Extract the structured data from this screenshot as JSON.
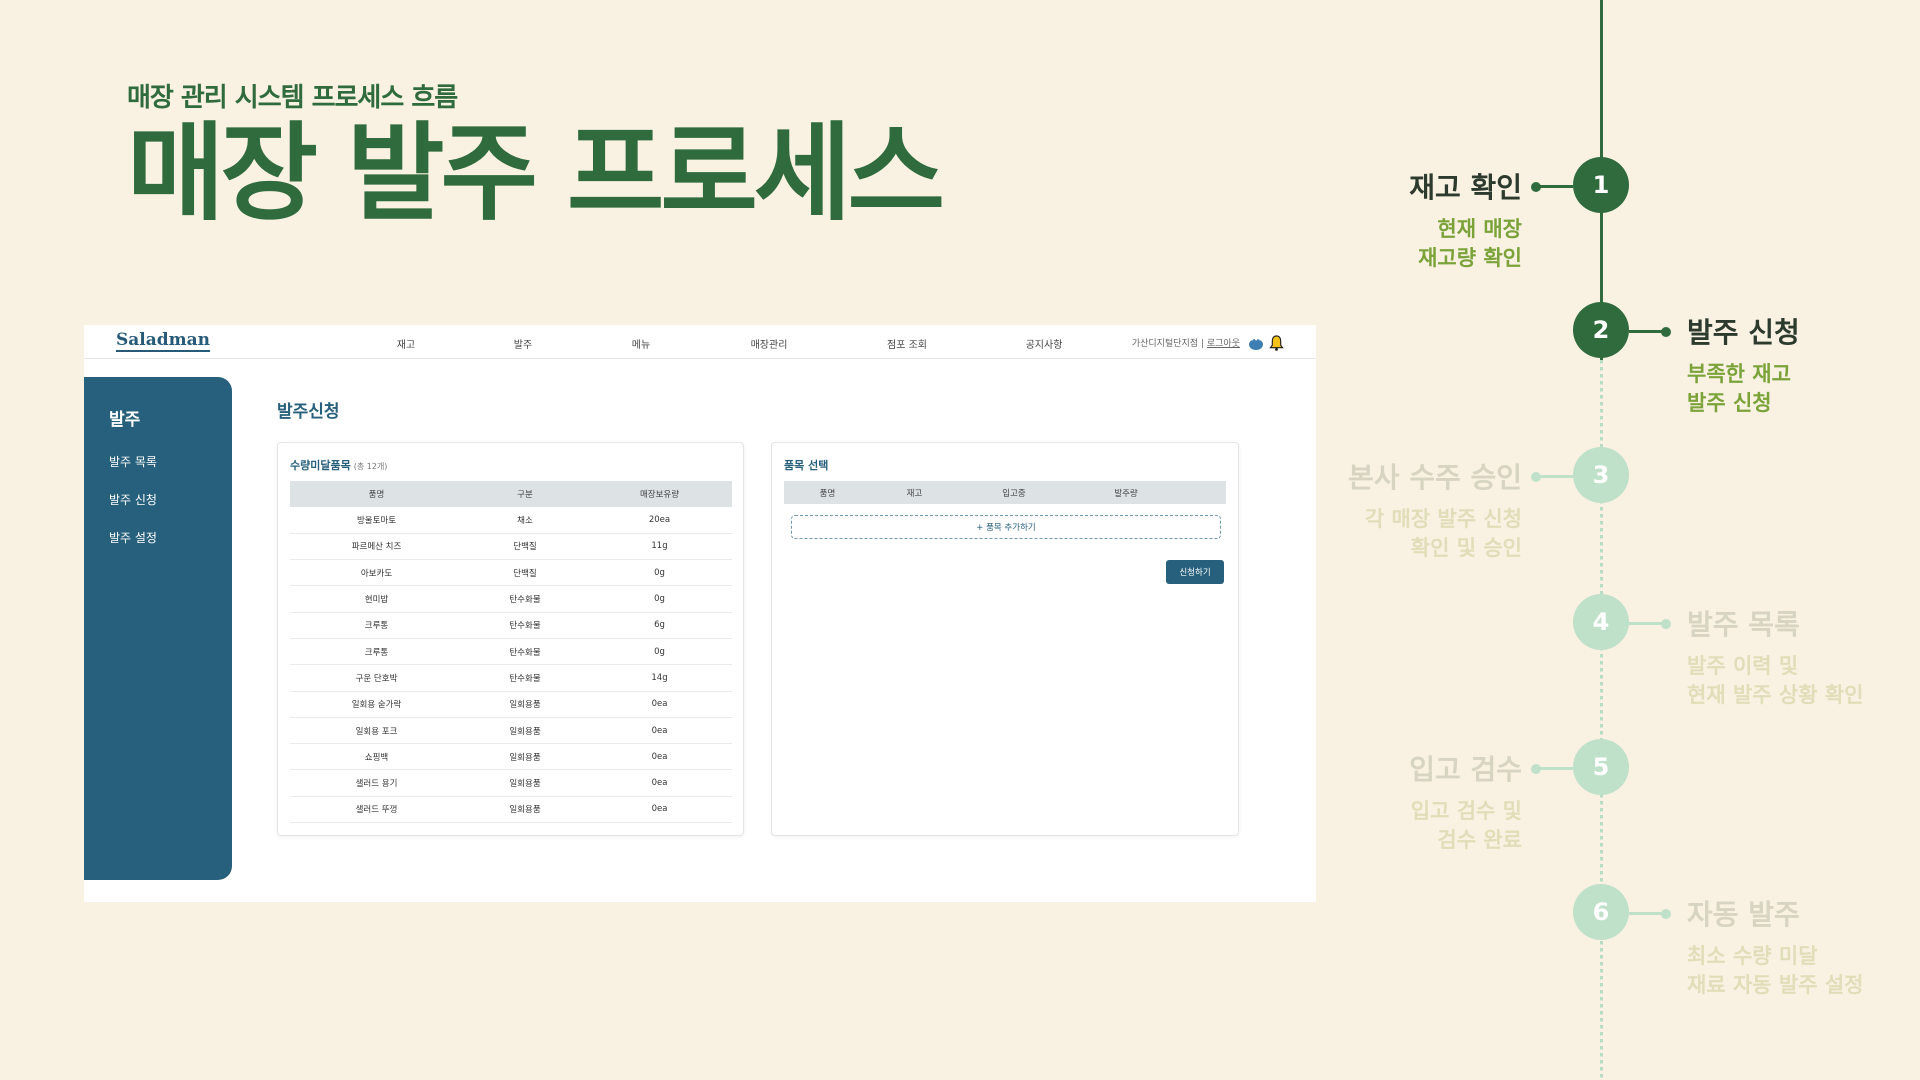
{
  "subtitle": "매장 관리 시스템 프로세스 흐름",
  "title": "매장 발주 프로세스",
  "app": {
    "logo": "Saladman",
    "nav": [
      "재고",
      "발주",
      "메뉴",
      "매장관리",
      "점포 조회",
      "공지사항"
    ],
    "store_name": "가산디지털단지점",
    "separator": "|",
    "logout": "로그아웃",
    "sidebar": {
      "title": "발주",
      "items": [
        "발주 목록",
        "발주 신청",
        "발주 설정"
      ]
    },
    "page_title": "발주신청",
    "shortage_panel": {
      "title": "수량미달품목",
      "count": "(총 12개)",
      "headers": [
        "품명",
        "구분",
        "매장보유량"
      ],
      "rows": [
        [
          "방울토마토",
          "채소",
          "20ea"
        ],
        [
          "파르메산 치즈",
          "단백질",
          "11g"
        ],
        [
          "아보카도",
          "단백질",
          "0g"
        ],
        [
          "현미밥",
          "탄수화물",
          "0g"
        ],
        [
          "크루통",
          "탄수화물",
          "6g"
        ],
        [
          "크루통",
          "탄수화물",
          "0g"
        ],
        [
          "구운 단호박",
          "탄수화물",
          "14g"
        ],
        [
          "일회용 숟가락",
          "일회용품",
          "0ea"
        ],
        [
          "일회용 포크",
          "일회용품",
          "0ea"
        ],
        [
          "쇼핑백",
          "일회용품",
          "0ea"
        ],
        [
          "샐러드 용기",
          "일회용품",
          "0ea"
        ],
        [
          "샐러드 뚜껑",
          "일회용품",
          "0ea"
        ]
      ]
    },
    "select_panel": {
      "title": "품목 선택",
      "headers": [
        "품명",
        "재고",
        "입고중",
        "발주량"
      ],
      "add_label": "+ 품목 추가하기",
      "submit_label": "신청하기"
    }
  },
  "steps": [
    {
      "num": "1",
      "title": "재고 확인",
      "desc1": "현재 매장",
      "desc2": "재고량 확인",
      "active": true
    },
    {
      "num": "2",
      "title": "발주 신청",
      "desc1": "부족한 재고",
      "desc2": "발주 신청",
      "active": true
    },
    {
      "num": "3",
      "title": "본사 수주 승인",
      "desc1": "각 매장 발주 신청",
      "desc2": "확인 및 승인",
      "active": false
    },
    {
      "num": "4",
      "title": "발주 목록",
      "desc1": "발주 이력 및",
      "desc2": "현재 발주 상황 확인",
      "active": false
    },
    {
      "num": "5",
      "title": "입고 검수",
      "desc1": "입고 검수 및",
      "desc2": "검수 완료",
      "active": false
    },
    {
      "num": "6",
      "title": "자동 발주",
      "desc1": "최소 수량 미달",
      "desc2": "재료 자동 발주 설정",
      "active": false
    }
  ],
  "colors": {
    "background": "#f9f2e3",
    "brand_green": "#2f6b3c",
    "brand_blue": "#27607c",
    "accent_olive": "#7ba33a",
    "inactive_node": "#bfe0c9"
  }
}
